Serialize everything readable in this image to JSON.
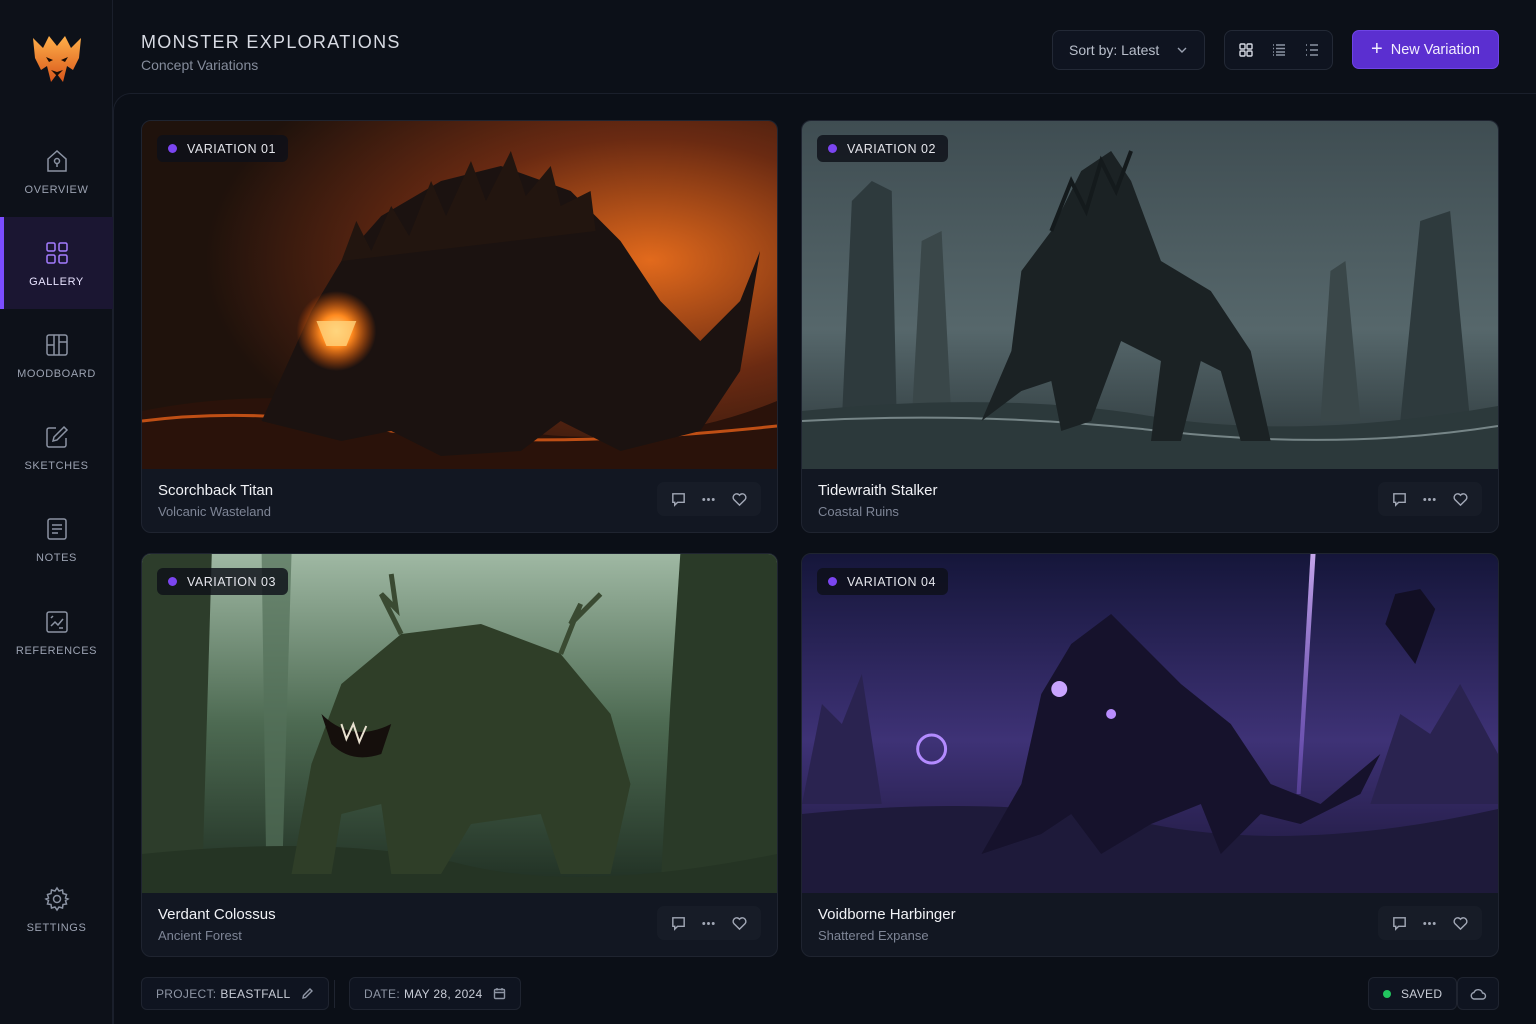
{
  "header": {
    "title": "MONSTER EXPLORATIONS",
    "subtitle": "Concept Variations",
    "sort_label": "Sort by: Latest",
    "new_button_label": "New Variation"
  },
  "sidebar": {
    "items": [
      {
        "label": "OVERVIEW",
        "icon": "home-icon",
        "active": false
      },
      {
        "label": "GALLERY",
        "icon": "grid-icon",
        "active": true
      },
      {
        "label": "MOODBOARD",
        "icon": "moodboard-icon",
        "active": false
      },
      {
        "label": "SKETCHES",
        "icon": "pencil-icon",
        "active": false
      },
      {
        "label": "NOTES",
        "icon": "notes-icon",
        "active": false
      },
      {
        "label": "REFERENCES",
        "icon": "references-icon",
        "active": false
      },
      {
        "label": "SETTINGS",
        "icon": "gear-icon",
        "active": false
      }
    ]
  },
  "view_modes": [
    {
      "icon": "grid-view-icon",
      "active": true
    },
    {
      "icon": "list-view-icon",
      "active": false
    },
    {
      "icon": "compact-list-icon",
      "active": false
    }
  ],
  "cards": [
    {
      "badge": "VARIATION 01",
      "name": "Scorchback Titan",
      "location": "Volcanic Wasteland",
      "theme": "volcanic"
    },
    {
      "badge": "VARIATION 02",
      "name": "Tidewraith Stalker",
      "location": "Coastal Ruins",
      "theme": "coastal"
    },
    {
      "badge": "VARIATION 03",
      "name": "Verdant Colossus",
      "location": "Ancient Forest",
      "theme": "forest"
    },
    {
      "badge": "VARIATION 04",
      "name": "Voidborne Harbinger",
      "location": "Shattered Expanse",
      "theme": "void"
    }
  ],
  "footer": {
    "project_key": "PROJECT:",
    "project_value": "BEASTFALL",
    "date_key": "DATE:",
    "date_value": "MAY 28, 2024",
    "status": "SAVED"
  },
  "colors": {
    "accent": "#7c4dff",
    "button": "#5b2fd0",
    "saved": "#22c55e",
    "logo": "#f08a2a"
  }
}
